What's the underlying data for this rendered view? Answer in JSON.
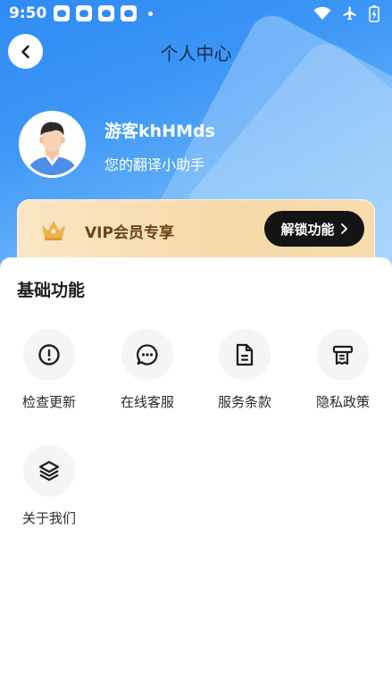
{
  "status_bar": {
    "time": "9:50",
    "notification_icons": [
      "baidu-paw-icon",
      "baidu-paw-icon",
      "baidu-paw-icon",
      "baidu-paw-icon"
    ],
    "right_icons": [
      "wifi-icon",
      "airplane-icon",
      "battery-charging-icon"
    ]
  },
  "header": {
    "title": "个人中心",
    "back_icon": "chevron-left-icon"
  },
  "profile": {
    "username": "游客khHMds",
    "subtitle": "您的翻译小助手",
    "avatar_icon": "user-avatar"
  },
  "vip": {
    "label": "VIP会员专享",
    "button_label": "解锁功能",
    "button_icon": "chevron-right-icon",
    "crown_icon": "crown-icon"
  },
  "basic": {
    "title": "基础功能",
    "items": [
      {
        "label": "检查更新",
        "icon": "alert-circle-icon"
      },
      {
        "label": "在线客服",
        "icon": "chat-bubble-icon"
      },
      {
        "label": "服务条款",
        "icon": "document-icon"
      },
      {
        "label": "隐私政策",
        "icon": "receipt-icon"
      },
      {
        "label": "关于我们",
        "icon": "layers-icon"
      }
    ]
  },
  "colors": {
    "header_blue": "#2f8bf5",
    "vip_gold": "#f6d9a8",
    "vip_text": "#6a4516",
    "button_dark": "#141414"
  }
}
